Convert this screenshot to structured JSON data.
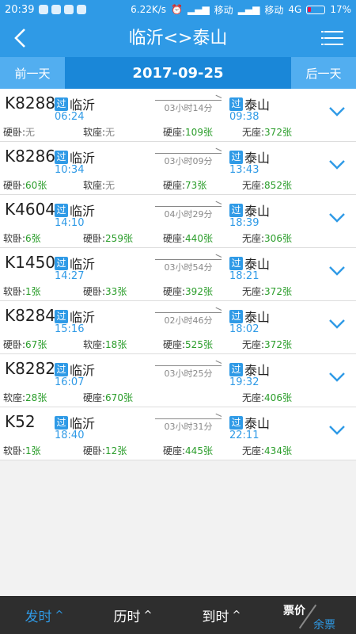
{
  "statusbar": {
    "time": "20:39",
    "speed": "6.22K/s",
    "carrier1": "移动",
    "carrier2": "移动",
    "network": "4G",
    "battery": "17%"
  },
  "header": {
    "title": "临沂<>泰山",
    "back_icon": "back-arrow-icon",
    "menu_icon": "list-menu-icon"
  },
  "datebar": {
    "prev": "前一天",
    "date": "2017-09-25",
    "next": "后一天"
  },
  "trains": [
    {
      "no": "K8288",
      "from": "临沂",
      "from_tag": "过",
      "dep": "06:24",
      "dur": "03小时14分",
      "to": "泰山",
      "to_tag": "过",
      "arr": "09:38",
      "seats": [
        {
          "label": "硬卧:",
          "value": "无"
        },
        {
          "label": "软座:",
          "value": "无"
        },
        {
          "label": "硬座:",
          "value": "109张"
        },
        {
          "label": "无座:",
          "value": "372张"
        }
      ]
    },
    {
      "no": "K8286",
      "from": "临沂",
      "from_tag": "过",
      "dep": "10:34",
      "dur": "03小时09分",
      "to": "泰山",
      "to_tag": "过",
      "arr": "13:43",
      "seats": [
        {
          "label": "硬卧:",
          "value": "60张"
        },
        {
          "label": "软座:",
          "value": "无"
        },
        {
          "label": "硬座:",
          "value": "73张"
        },
        {
          "label": "无座:",
          "value": "852张"
        }
      ]
    },
    {
      "no": "K4604",
      "from": "临沂",
      "from_tag": "过",
      "dep": "14:10",
      "dur": "04小时29分",
      "to": "泰山",
      "to_tag": "过",
      "arr": "18:39",
      "seats": [
        {
          "label": "软卧:",
          "value": "6张"
        },
        {
          "label": "硬卧:",
          "value": "259张"
        },
        {
          "label": "硬座:",
          "value": "440张"
        },
        {
          "label": "无座:",
          "value": "306张"
        }
      ]
    },
    {
      "no": "K1450",
      "from": "临沂",
      "from_tag": "过",
      "dep": "14:27",
      "dur": "03小时54分",
      "to": "泰山",
      "to_tag": "过",
      "arr": "18:21",
      "seats": [
        {
          "label": "软卧:",
          "value": "1张"
        },
        {
          "label": "硬卧:",
          "value": "33张"
        },
        {
          "label": "硬座:",
          "value": "392张"
        },
        {
          "label": "无座:",
          "value": "372张"
        }
      ]
    },
    {
      "no": "K8284",
      "from": "临沂",
      "from_tag": "过",
      "dep": "15:16",
      "dur": "02小时46分",
      "to": "泰山",
      "to_tag": "过",
      "arr": "18:02",
      "seats": [
        {
          "label": "硬卧:",
          "value": "67张"
        },
        {
          "label": "软座:",
          "value": "18张"
        },
        {
          "label": "硬座:",
          "value": "525张"
        },
        {
          "label": "无座:",
          "value": "372张"
        }
      ]
    },
    {
      "no": "K8282",
      "from": "临沂",
      "from_tag": "过",
      "dep": "16:07",
      "dur": "03小时25分",
      "to": "泰山",
      "to_tag": "过",
      "arr": "19:32",
      "seats": [
        {
          "label": "软座:",
          "value": "28张"
        },
        {
          "label": "硬座:",
          "value": "670张"
        },
        {
          "label": "无座:",
          "value": "406张"
        }
      ]
    },
    {
      "no": "K52",
      "from": "临沂",
      "from_tag": "过",
      "dep": "18:40",
      "dur": "03小时31分",
      "to": "泰山",
      "to_tag": "过",
      "arr": "22:11",
      "seats": [
        {
          "label": "软卧:",
          "value": "1张"
        },
        {
          "label": "硬卧:",
          "value": "12张"
        },
        {
          "label": "硬座:",
          "value": "445张"
        },
        {
          "label": "无座:",
          "value": "434张"
        }
      ]
    }
  ],
  "bottombar": {
    "sort_depart": "发时",
    "sort_duration": "历时",
    "sort_arrive": "到时",
    "price": "票价",
    "remaining": "余票",
    "caret": "^"
  },
  "colors": {
    "accent": "#2f9ae6",
    "available": "#2a9d2a",
    "bar": "#2e2e2e"
  }
}
